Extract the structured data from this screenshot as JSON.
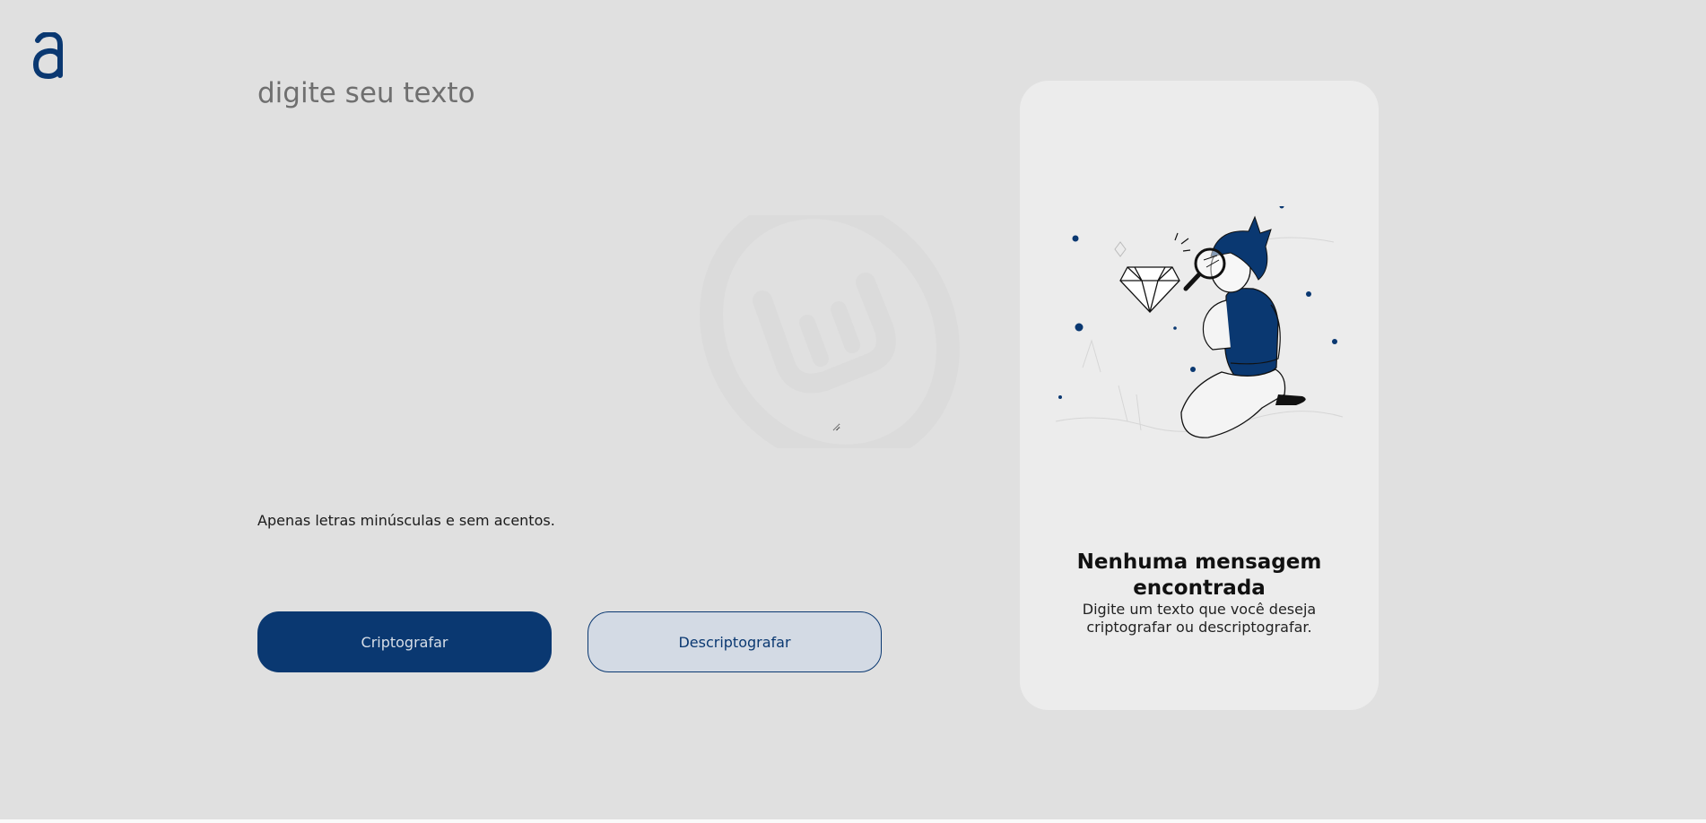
{
  "brand": {
    "logo_letter": "a",
    "accent_color": "#0a3871"
  },
  "editor": {
    "placeholder": "digite seu texto",
    "value": ""
  },
  "hint": {
    "icon": "info-icon",
    "text": "Apenas letras minúsculas e sem acentos."
  },
  "actions": {
    "encrypt_label": "Criptografar",
    "decrypt_label": "Descriptografar"
  },
  "output_card": {
    "illustration": "person-with-magnifier-and-diamond",
    "title": "Nenhuma mensagem encontrada",
    "text": "Digite um texto que você deseja criptografar ou descriptografar."
  },
  "background": {
    "watermark": "linux-mint-logo"
  }
}
